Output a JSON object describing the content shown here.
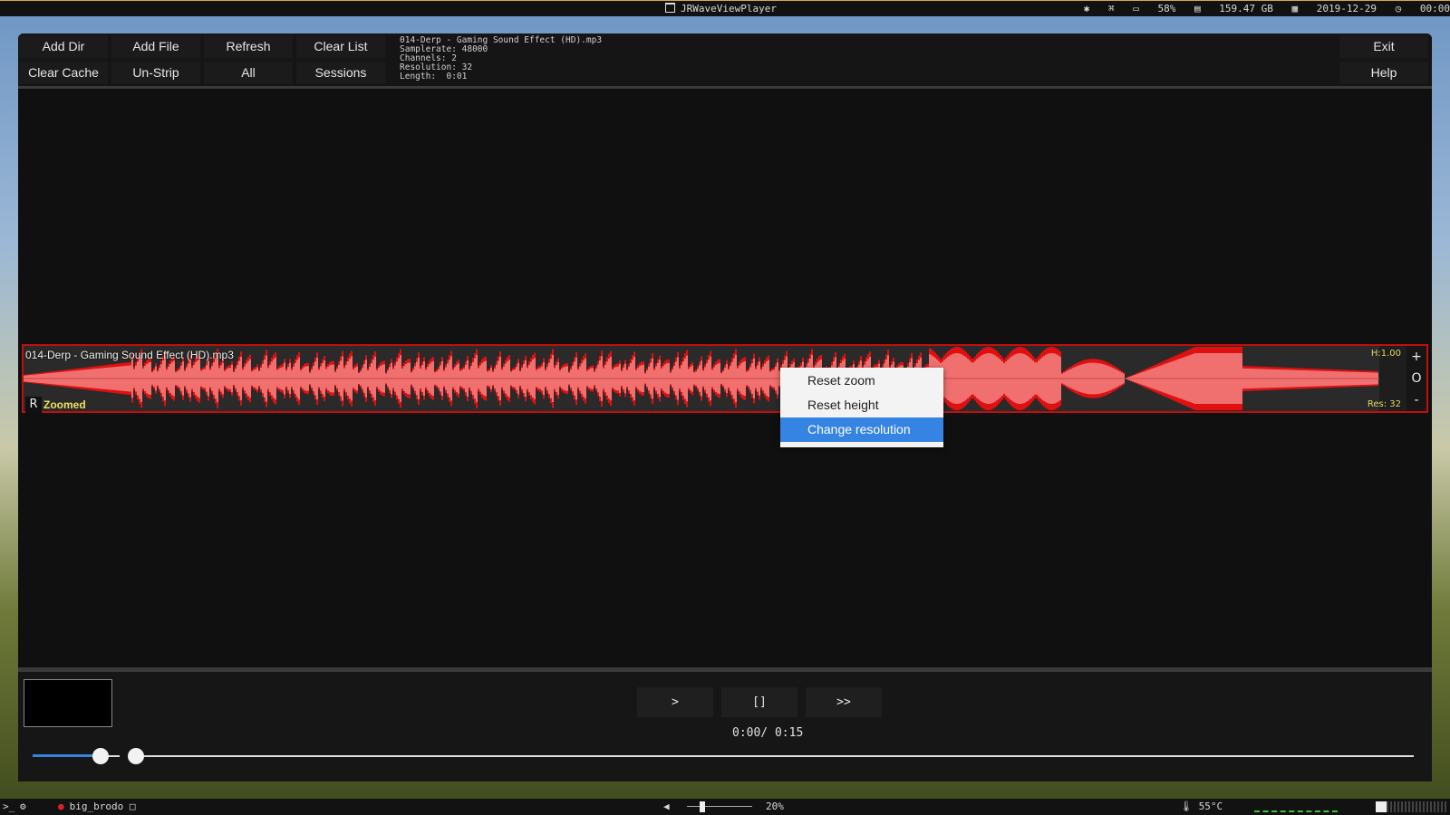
{
  "topbar": {
    "window_title": "JRWaveViewPlayer",
    "battery": "58%",
    "disk": "159.47 GB",
    "date": "2019-12-29",
    "time": "00:00"
  },
  "toolbar": {
    "add_dir": "Add Dir",
    "add_file": "Add File",
    "refresh": "Refresh",
    "clear_list": "Clear List",
    "clear_cache": "Clear Cache",
    "un_strip": "Un-Strip",
    "all": "All",
    "sessions": "Sessions",
    "exit": "Exit",
    "help": "Help"
  },
  "file_info": {
    "filename": "014-Derp - Gaming Sound Effect (HD).mp3",
    "samplerate": "Samplerate: 48000",
    "channels": "Channels: 2",
    "resolution": "Resolution: 32",
    "length": "Length:  0:01"
  },
  "track": {
    "name": "014-Derp - Gaming Sound Effect (HD).mp3",
    "r_button": "R",
    "zoomed": "Zoomed",
    "height": "H:1.00",
    "res": "Res: 32",
    "zoom_in": "+",
    "zoom_reset": "O",
    "zoom_out": "-",
    "wave_color": "#f07070",
    "wave_peak_color": "#e01010"
  },
  "context_menu": {
    "items": [
      "Reset zoom",
      "Reset height",
      "Change resolution"
    ],
    "selected": "Change resolution"
  },
  "player": {
    "play": ">",
    "stop": "[]",
    "next": ">>",
    "time": "0:00/ 0:15",
    "volume_fraction": 0.78,
    "seek_fraction": 0.0
  },
  "bottombar": {
    "terminal": ">_",
    "user": "big_brodo",
    "volume_pct": "20%",
    "volume_fraction": 0.2,
    "temperature": "55°C",
    "memory_fraction": 0.15
  },
  "colors": {
    "accent": "#3584e4",
    "track_border": "#c20e0e",
    "label_yellow": "#e6d760"
  }
}
